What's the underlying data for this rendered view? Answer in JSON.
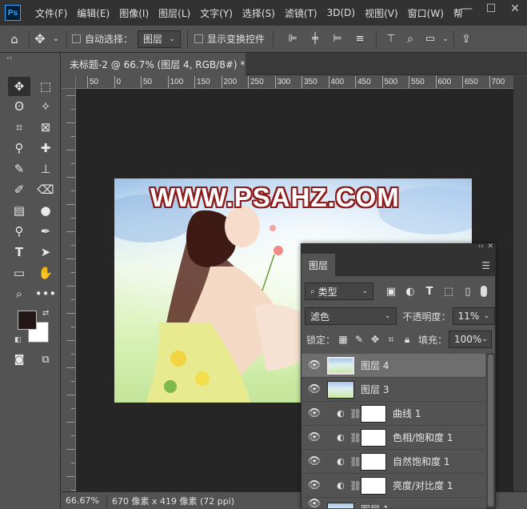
{
  "app": {
    "logo_text": "Ps"
  },
  "menu": [
    "文件(F)",
    "编辑(E)",
    "图像(I)",
    "图层(L)",
    "文字(Y)",
    "选择(S)",
    "滤镜(T)",
    "3D(D)",
    "视图(V)",
    "窗口(W)",
    "帮"
  ],
  "window_controls": {
    "minimize": "—",
    "maximize": "☐",
    "close": "✕"
  },
  "options_bar": {
    "auto_select_label": "自动选择：",
    "auto_select_value": "图层",
    "show_transform_label": "显示变换控件"
  },
  "toolbar": {
    "collapse": "‹‹"
  },
  "document": {
    "tab_title": "未标题-2 @ 66.7% (图层 4, RGB/8#) *",
    "close": "×"
  },
  "ruler": {
    "h_ticks": [
      "50",
      "0",
      "50",
      "100",
      "150",
      "200",
      "250",
      "300",
      "350",
      "400",
      "450",
      "500",
      "550",
      "600",
      "650",
      "700"
    ]
  },
  "canvas": {
    "watermark": "WWW.PSAHZ.COM"
  },
  "status": {
    "zoom": "66.67%",
    "doc_size": "670 像素 x 419 像素 (72 ppi)"
  },
  "layers_panel": {
    "collapse": "‹‹",
    "close": "✕",
    "tab": "图层",
    "filter_kind": "类型",
    "blend_mode": "滤色",
    "opacity_label": "不透明度：",
    "opacity_value": "11%",
    "lock_label": "锁定：",
    "fill_label": "填充：",
    "fill_value": "100%",
    "layers": [
      {
        "name": "图层 4",
        "type": "image",
        "selected": true
      },
      {
        "name": "图层 3",
        "type": "image",
        "selected": false
      },
      {
        "name": "曲线 1",
        "type": "adjustment",
        "selected": false
      },
      {
        "name": "色相/饱和度 1",
        "type": "adjustment",
        "selected": false
      },
      {
        "name": "自然饱和度 1",
        "type": "adjustment",
        "selected": false
      },
      {
        "name": "亮度/对比度 1",
        "type": "adjustment",
        "selected": false
      },
      {
        "name": "图层 1",
        "type": "image",
        "selected": false
      }
    ]
  },
  "colors": {
    "foreground": "#231716",
    "background": "#ffffff",
    "watermark_outline": "#8c1a1a"
  }
}
